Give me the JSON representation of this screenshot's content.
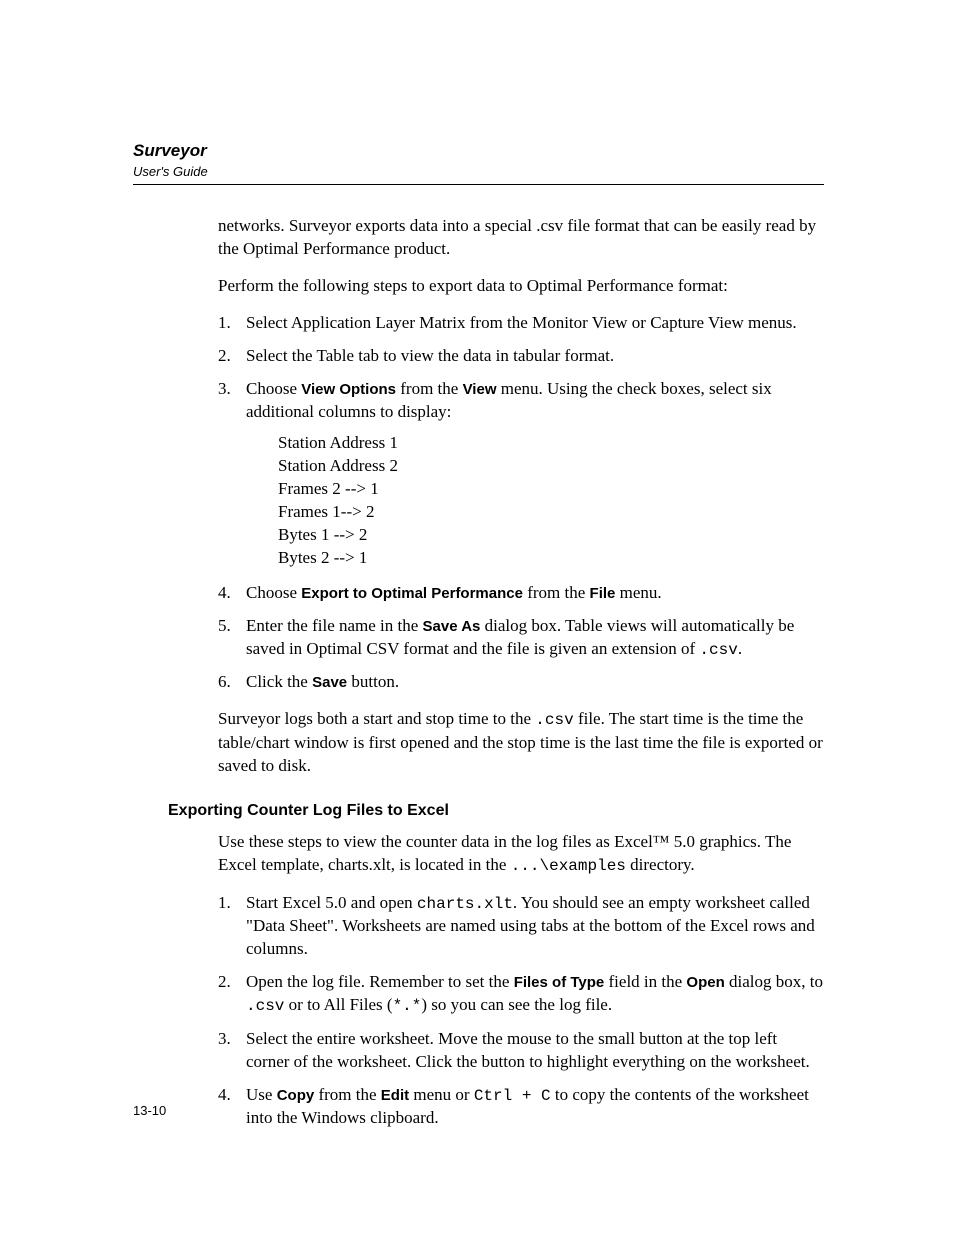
{
  "header": {
    "title": "Surveyor",
    "subtitle": "User's Guide"
  },
  "intro": {
    "p1": "networks. Surveyor exports data into a special .csv file format that can be easily read by the Optimal Performance product.",
    "p2": "Perform the following steps to export data to Optimal Performance format:"
  },
  "steps1": [
    {
      "num": "1.",
      "plain": "Select Application Layer Matrix from the Monitor View or Capture View menus."
    },
    {
      "num": "2.",
      "plain": "Select the Table tab to view the data in tabular format."
    },
    {
      "num": "3.",
      "parts": [
        "Choose ",
        "View Options",
        " from the ",
        "View",
        " menu. Using the check boxes, select six additional columns to display:"
      ],
      "columns": [
        "Station Address 1",
        "Station Address 2",
        "Frames 2 --> 1",
        "Frames 1--> 2",
        "Bytes 1 --> 2",
        "Bytes 2 --> 1"
      ]
    },
    {
      "num": "4.",
      "parts": [
        "Choose ",
        "Export to Optimal Performance",
        " from the ",
        "File",
        " menu."
      ]
    },
    {
      "num": "5.",
      "parts5": [
        "Enter the file name in the ",
        "Save As",
        " dialog box. Table views will automatically be saved in Optimal CSV format and the file is given an extension of ",
        ".csv",
        "."
      ]
    },
    {
      "num": "6.",
      "parts6": [
        "Click the ",
        "Save",
        " button."
      ]
    }
  ],
  "after1": {
    "parts": [
      "Surveyor logs both a start and stop time to the ",
      ".csv",
      " file. The start time is the time the table/chart window is first opened and the stop time is the last time the file is exported or saved to disk."
    ]
  },
  "section2": {
    "heading": "Exporting Counter Log Files to Excel",
    "intro_parts": [
      "Use these steps to view the counter data in the log files as Excel™ 5.0 graphics. The Excel template, charts.xlt, is located in the ",
      "...\\examples",
      " directory."
    ]
  },
  "steps2": [
    {
      "num": "1.",
      "partsA": [
        "Start Excel 5.0 and open ",
        "charts.xlt",
        ". You should see an empty worksheet called \"Data Sheet\". Worksheets are named using tabs at the bottom of the Excel rows and columns."
      ]
    },
    {
      "num": "2.",
      "partsB": [
        "Open the log file. Remember to set the ",
        "Files of Type",
        " field in the ",
        "Open",
        " dialog box, to ",
        ".csv",
        " or to All Files (",
        "*.*",
        ") so you can see the log file."
      ]
    },
    {
      "num": "3.",
      "plain": "Select the entire worksheet. Move the mouse to the small button at the top left corner of the worksheet. Click the button to highlight everything on the worksheet."
    },
    {
      "num": "4.",
      "partsD": [
        "Use ",
        "Copy",
        " from the ",
        "Edit",
        " menu or ",
        "Ctrl + C",
        " to copy the contents of the worksheet into the Windows clipboard."
      ]
    }
  ],
  "page_number": "13-10"
}
